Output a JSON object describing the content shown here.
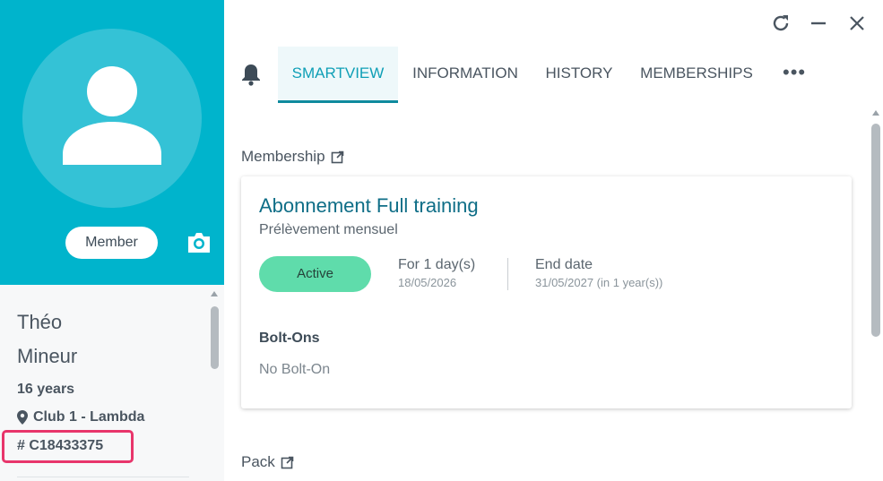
{
  "colors": {
    "hero_bg": "#00b4cc",
    "avatar_bg": "#34c2d6",
    "tab_active_text": "#0f9fb6",
    "tab_active_underline": "#0f8a9e",
    "status_active": "#5fdcab",
    "plan_title": "#0f6e87",
    "highlight": "#e8356b"
  },
  "profile": {
    "role_label": "Member",
    "first_name": "Théo",
    "last_name": "Mineur",
    "age": "16 years",
    "club": "Club 1 - Lambda",
    "member_id": "# C18433375",
    "icons": {
      "avatar": "user-avatar-icon",
      "camera": "camera-icon",
      "location": "map-pin-icon"
    }
  },
  "window": {
    "icons": [
      "refresh-icon",
      "minimize-icon",
      "close-icon"
    ]
  },
  "tabs": {
    "items": [
      {
        "label": "SMARTVIEW",
        "active": true
      },
      {
        "label": "INFORMATION",
        "active": false
      },
      {
        "label": "HISTORY",
        "active": false
      },
      {
        "label": "MEMBERSHIPS",
        "active": false
      }
    ],
    "more_label": "•••",
    "bell_icon": "bell-icon"
  },
  "membership_section": {
    "title": "Membership",
    "card": {
      "plan_name": "Abonnement Full training",
      "plan_subtitle": "Prélèvement mensuel",
      "status": "Active",
      "period_label": "For 1 day(s)",
      "period_date": "18/05/2026",
      "end_label": "End date",
      "end_date": "31/05/2027 (in 1 year(s))",
      "boltons_title": "Bolt-Ons",
      "boltons_empty": "No Bolt-On"
    }
  },
  "pack_section": {
    "title": "Pack"
  }
}
